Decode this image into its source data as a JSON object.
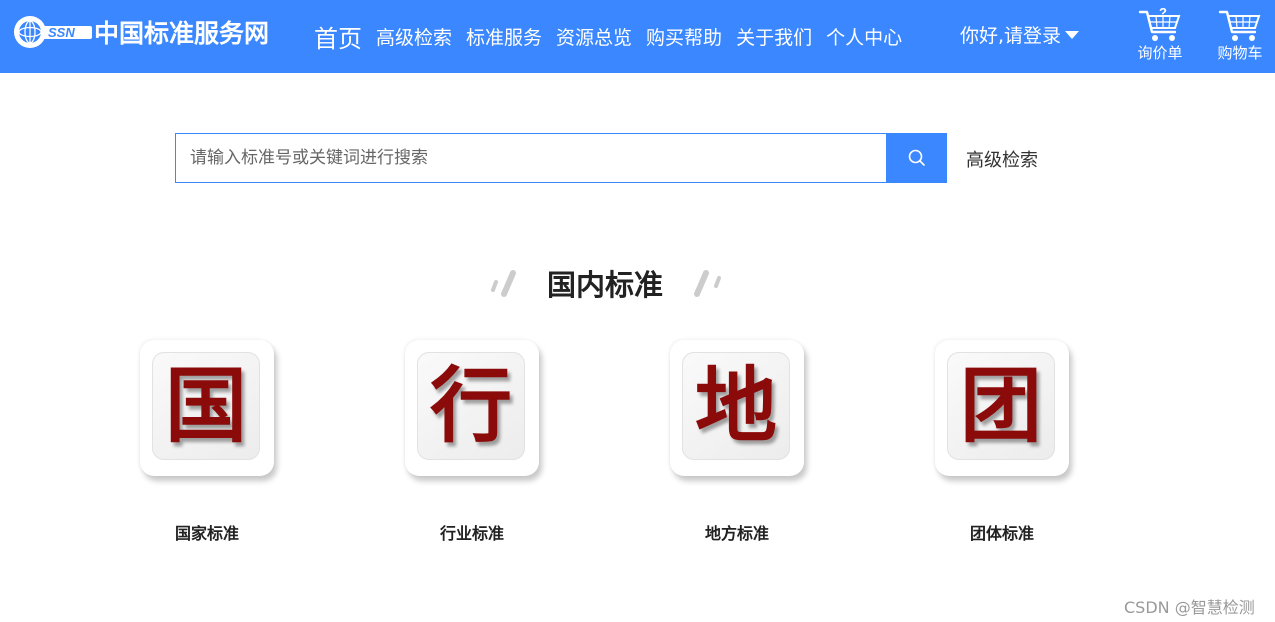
{
  "header": {
    "logo_abbr": "SSN",
    "logo_text": "中国标准服务网",
    "nav": [
      {
        "label": "首页"
      },
      {
        "label": "高级检索"
      },
      {
        "label": "标准服务"
      },
      {
        "label": "资源总览"
      },
      {
        "label": "购买帮助"
      },
      {
        "label": "关于我们"
      },
      {
        "label": "个人中心"
      }
    ],
    "login_label": "你好,请登录",
    "inquiry_label": "询价单",
    "cart_label": "购物车"
  },
  "search": {
    "placeholder": "请输入标准号或关键词进行搜索",
    "value": "",
    "advanced_label": "高级检索"
  },
  "section": {
    "title": "国内标准"
  },
  "categories": [
    {
      "char": "国",
      "label": "国家标准"
    },
    {
      "char": "行",
      "label": "行业标准"
    },
    {
      "char": "地",
      "label": "地方标准"
    },
    {
      "char": "团",
      "label": "团体标准"
    }
  ],
  "colors": {
    "brand": "#3a87ff",
    "tile_char": "#8b0a0a"
  },
  "watermark": "CSDN @智慧检测"
}
